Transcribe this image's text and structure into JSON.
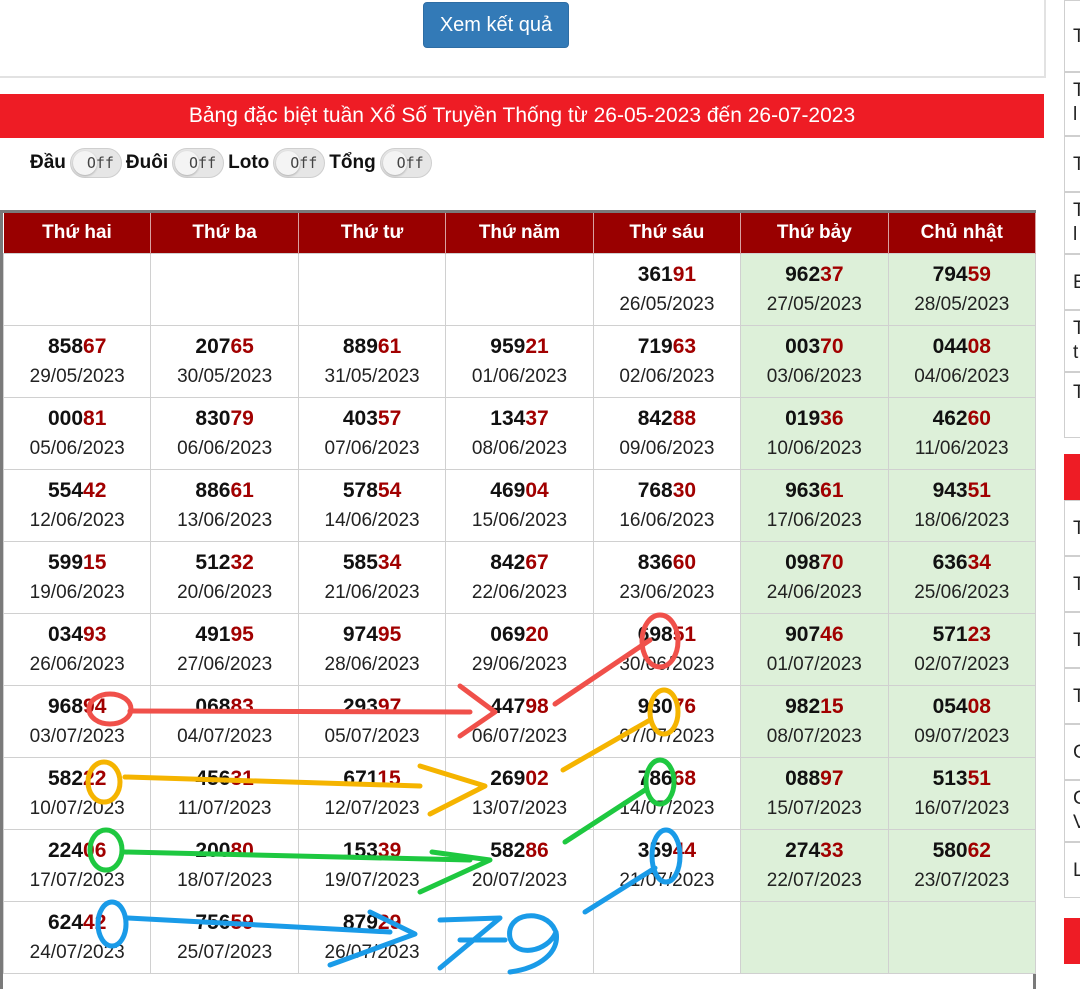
{
  "button": {
    "label": "Xem kết quả"
  },
  "banner": {
    "title": "Bảng đặc biệt tuần Xổ Số Truyền Thống từ 26-05-2023 đến 26-07-2023"
  },
  "toggles": [
    {
      "label": "Đầu",
      "state": "Off"
    },
    {
      "label": "Đuôi",
      "state": "Off"
    },
    {
      "label": "Loto",
      "state": "Off"
    },
    {
      "label": "Tổng",
      "state": "Off"
    }
  ],
  "table": {
    "headers": [
      "Thứ hai",
      "Thứ ba",
      "Thứ tư",
      "Thứ năm",
      "Thứ sáu",
      "Thứ bảy",
      "Chủ nhật"
    ],
    "rows": [
      [
        {
          "head": "",
          "tail": "",
          "date": ""
        },
        {
          "head": "",
          "tail": "",
          "date": ""
        },
        {
          "head": "",
          "tail": "",
          "date": ""
        },
        {
          "head": "",
          "tail": "",
          "date": ""
        },
        {
          "head": "361",
          "tail": "91",
          "date": "26/05/2023"
        },
        {
          "head": "962",
          "tail": "37",
          "date": "27/05/2023"
        },
        {
          "head": "794",
          "tail": "59",
          "date": "28/05/2023"
        }
      ],
      [
        {
          "head": "858",
          "tail": "67",
          "date": "29/05/2023"
        },
        {
          "head": "207",
          "tail": "65",
          "date": "30/05/2023"
        },
        {
          "head": "889",
          "tail": "61",
          "date": "31/05/2023"
        },
        {
          "head": "959",
          "tail": "21",
          "date": "01/06/2023"
        },
        {
          "head": "719",
          "tail": "63",
          "date": "02/06/2023"
        },
        {
          "head": "003",
          "tail": "70",
          "date": "03/06/2023"
        },
        {
          "head": "044",
          "tail": "08",
          "date": "04/06/2023"
        }
      ],
      [
        {
          "head": "000",
          "tail": "81",
          "date": "05/06/2023"
        },
        {
          "head": "830",
          "tail": "79",
          "date": "06/06/2023"
        },
        {
          "head": "403",
          "tail": "57",
          "date": "07/06/2023"
        },
        {
          "head": "134",
          "tail": "37",
          "date": "08/06/2023"
        },
        {
          "head": "842",
          "tail": "88",
          "date": "09/06/2023"
        },
        {
          "head": "019",
          "tail": "36",
          "date": "10/06/2023"
        },
        {
          "head": "462",
          "tail": "60",
          "date": "11/06/2023"
        }
      ],
      [
        {
          "head": "554",
          "tail": "42",
          "date": "12/06/2023"
        },
        {
          "head": "886",
          "tail": "61",
          "date": "13/06/2023"
        },
        {
          "head": "578",
          "tail": "54",
          "date": "14/06/2023"
        },
        {
          "head": "469",
          "tail": "04",
          "date": "15/06/2023"
        },
        {
          "head": "768",
          "tail": "30",
          "date": "16/06/2023"
        },
        {
          "head": "963",
          "tail": "61",
          "date": "17/06/2023"
        },
        {
          "head": "943",
          "tail": "51",
          "date": "18/06/2023"
        }
      ],
      [
        {
          "head": "599",
          "tail": "15",
          "date": "19/06/2023"
        },
        {
          "head": "512",
          "tail": "32",
          "date": "20/06/2023"
        },
        {
          "head": "585",
          "tail": "34",
          "date": "21/06/2023"
        },
        {
          "head": "842",
          "tail": "67",
          "date": "22/06/2023"
        },
        {
          "head": "836",
          "tail": "60",
          "date": "23/06/2023"
        },
        {
          "head": "098",
          "tail": "70",
          "date": "24/06/2023"
        },
        {
          "head": "636",
          "tail": "34",
          "date": "25/06/2023"
        }
      ],
      [
        {
          "head": "034",
          "tail": "93",
          "date": "26/06/2023"
        },
        {
          "head": "491",
          "tail": "95",
          "date": "27/06/2023"
        },
        {
          "head": "974",
          "tail": "95",
          "date": "28/06/2023"
        },
        {
          "head": "069",
          "tail": "20",
          "date": "29/06/2023"
        },
        {
          "head": "698",
          "tail": "51",
          "date": "30/06/2023"
        },
        {
          "head": "907",
          "tail": "46",
          "date": "01/07/2023"
        },
        {
          "head": "571",
          "tail": "23",
          "date": "02/07/2023"
        }
      ],
      [
        {
          "head": "968",
          "tail": "94",
          "date": "03/07/2023"
        },
        {
          "head": "068",
          "tail": "83",
          "date": "04/07/2023"
        },
        {
          "head": "293",
          "tail": "97",
          "date": "05/07/2023"
        },
        {
          "head": "447",
          "tail": "98",
          "date": "06/07/2023"
        },
        {
          "head": "930",
          "tail": "76",
          "date": "07/07/2023"
        },
        {
          "head": "982",
          "tail": "15",
          "date": "08/07/2023"
        },
        {
          "head": "054",
          "tail": "08",
          "date": "09/07/2023"
        }
      ],
      [
        {
          "head": "582",
          "tail": "22",
          "date": "10/07/2023"
        },
        {
          "head": "456",
          "tail": "31",
          "date": "11/07/2023"
        },
        {
          "head": "671",
          "tail": "15",
          "date": "12/07/2023"
        },
        {
          "head": "269",
          "tail": "02",
          "date": "13/07/2023"
        },
        {
          "head": "786",
          "tail": "68",
          "date": "14/07/2023"
        },
        {
          "head": "088",
          "tail": "97",
          "date": "15/07/2023"
        },
        {
          "head": "513",
          "tail": "51",
          "date": "16/07/2023"
        }
      ],
      [
        {
          "head": "224",
          "tail": "06",
          "date": "17/07/2023"
        },
        {
          "head": "200",
          "tail": "80",
          "date": "18/07/2023"
        },
        {
          "head": "153",
          "tail": "39",
          "date": "19/07/2023"
        },
        {
          "head": "582",
          "tail": "86",
          "date": "20/07/2023"
        },
        {
          "head": "359",
          "tail": "44",
          "date": "21/07/2023"
        },
        {
          "head": "274",
          "tail": "33",
          "date": "22/07/2023"
        },
        {
          "head": "580",
          "tail": "62",
          "date": "23/07/2023"
        }
      ],
      [
        {
          "head": "624",
          "tail": "42",
          "date": "24/07/2023"
        },
        {
          "head": "756",
          "tail": "59",
          "date": "25/07/2023"
        },
        {
          "head": "879",
          "tail": "29",
          "date": "26/07/2023"
        },
        {
          "head": "",
          "tail": "",
          "date": ""
        },
        {
          "head": "",
          "tail": "",
          "date": ""
        },
        {
          "head": "",
          "tail": "",
          "date": ""
        },
        {
          "head": "",
          "tail": "",
          "date": ""
        }
      ]
    ]
  },
  "sidebar": {
    "letters": [
      "T",
      "T",
      "l",
      "T",
      "T",
      "l",
      "E",
      "T",
      "t",
      "T",
      "T",
      "T",
      "T",
      "T",
      "C",
      "C",
      "V",
      "L"
    ]
  },
  "annotation": {
    "handwritten": "79"
  },
  "colors": {
    "header_bg": "#990000",
    "banner_bg": "#ee1c25",
    "button_bg": "#337ab7",
    "tail_digits": "#a10000",
    "weekend_bg": "#ddf0d9"
  }
}
